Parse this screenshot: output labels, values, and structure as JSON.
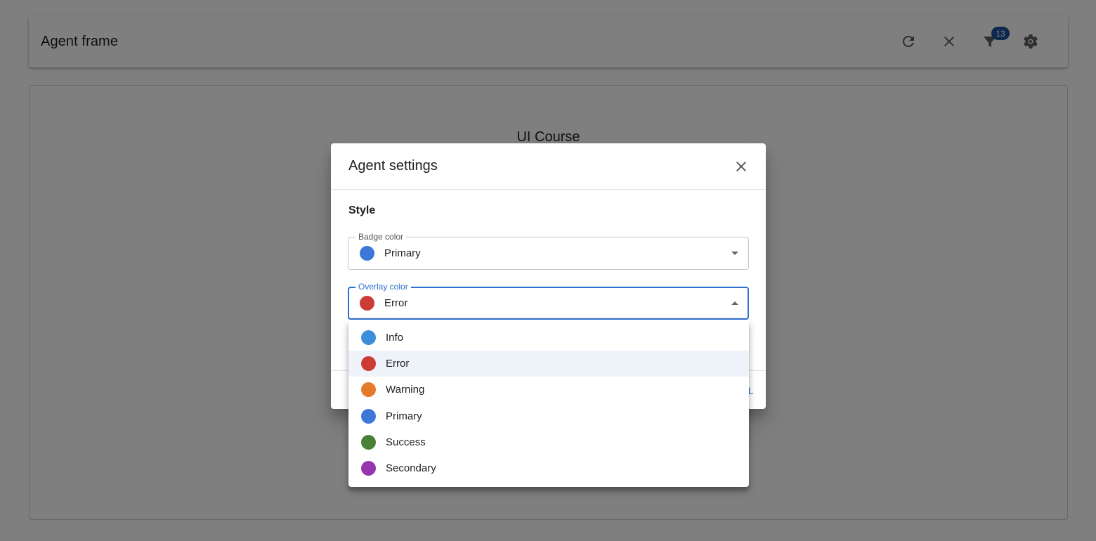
{
  "header": {
    "title": "Agent frame",
    "filter_badge": "13",
    "icons": [
      "refresh-icon",
      "close-icon",
      "filter-icon",
      "gear-icon"
    ]
  },
  "content": {
    "title": "UI Course"
  },
  "dialog": {
    "title": "Agent settings",
    "section_title": "Style",
    "badge_color": {
      "label": "Badge color",
      "value": "Primary",
      "color": "#3b78d8"
    },
    "overlay_color": {
      "label": "Overlay color",
      "value": "Error",
      "color": "#cc3b34"
    },
    "footer_action_partial": "L"
  },
  "menu": {
    "options": [
      {
        "label": "Info",
        "color": "#3b8fd9"
      },
      {
        "label": "Error",
        "color": "#cc3b34"
      },
      {
        "label": "Warning",
        "color": "#e57a2b"
      },
      {
        "label": "Primary",
        "color": "#3b78d8"
      },
      {
        "label": "Success",
        "color": "#4b8037"
      },
      {
        "label": "Secondary",
        "color": "#9635b0"
      }
    ],
    "selected": "Error"
  },
  "colors": {
    "accent": "#2f6fd1",
    "badge": "#1c4e9d"
  }
}
